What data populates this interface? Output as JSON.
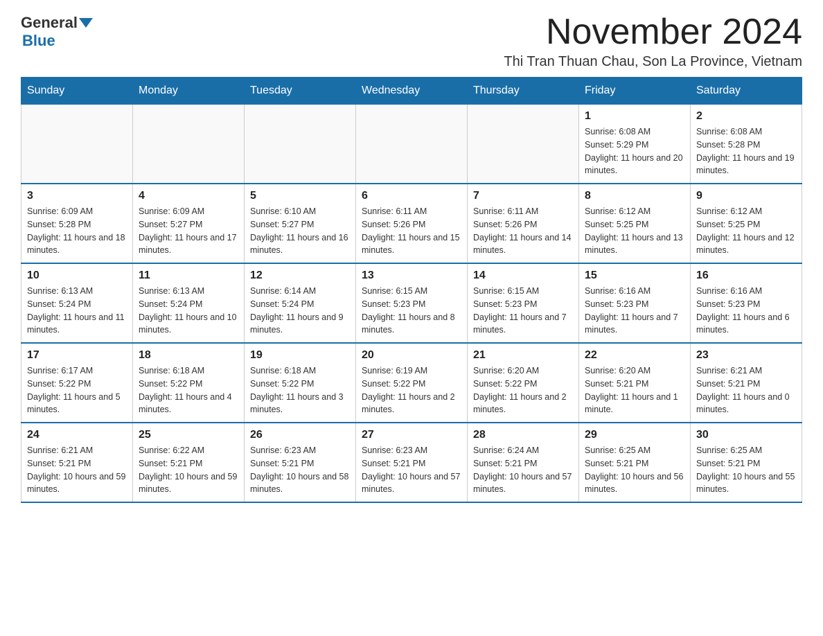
{
  "logo": {
    "general": "General",
    "blue": "Blue"
  },
  "header": {
    "month_title": "November 2024",
    "location": "Thi Tran Thuan Chau, Son La Province, Vietnam"
  },
  "weekdays": [
    "Sunday",
    "Monday",
    "Tuesday",
    "Wednesday",
    "Thursday",
    "Friday",
    "Saturday"
  ],
  "weeks": [
    [
      {
        "day": "",
        "info": ""
      },
      {
        "day": "",
        "info": ""
      },
      {
        "day": "",
        "info": ""
      },
      {
        "day": "",
        "info": ""
      },
      {
        "day": "",
        "info": ""
      },
      {
        "day": "1",
        "info": "Sunrise: 6:08 AM\nSunset: 5:29 PM\nDaylight: 11 hours and 20 minutes."
      },
      {
        "day": "2",
        "info": "Sunrise: 6:08 AM\nSunset: 5:28 PM\nDaylight: 11 hours and 19 minutes."
      }
    ],
    [
      {
        "day": "3",
        "info": "Sunrise: 6:09 AM\nSunset: 5:28 PM\nDaylight: 11 hours and 18 minutes."
      },
      {
        "day": "4",
        "info": "Sunrise: 6:09 AM\nSunset: 5:27 PM\nDaylight: 11 hours and 17 minutes."
      },
      {
        "day": "5",
        "info": "Sunrise: 6:10 AM\nSunset: 5:27 PM\nDaylight: 11 hours and 16 minutes."
      },
      {
        "day": "6",
        "info": "Sunrise: 6:11 AM\nSunset: 5:26 PM\nDaylight: 11 hours and 15 minutes."
      },
      {
        "day": "7",
        "info": "Sunrise: 6:11 AM\nSunset: 5:26 PM\nDaylight: 11 hours and 14 minutes."
      },
      {
        "day": "8",
        "info": "Sunrise: 6:12 AM\nSunset: 5:25 PM\nDaylight: 11 hours and 13 minutes."
      },
      {
        "day": "9",
        "info": "Sunrise: 6:12 AM\nSunset: 5:25 PM\nDaylight: 11 hours and 12 minutes."
      }
    ],
    [
      {
        "day": "10",
        "info": "Sunrise: 6:13 AM\nSunset: 5:24 PM\nDaylight: 11 hours and 11 minutes."
      },
      {
        "day": "11",
        "info": "Sunrise: 6:13 AM\nSunset: 5:24 PM\nDaylight: 11 hours and 10 minutes."
      },
      {
        "day": "12",
        "info": "Sunrise: 6:14 AM\nSunset: 5:24 PM\nDaylight: 11 hours and 9 minutes."
      },
      {
        "day": "13",
        "info": "Sunrise: 6:15 AM\nSunset: 5:23 PM\nDaylight: 11 hours and 8 minutes."
      },
      {
        "day": "14",
        "info": "Sunrise: 6:15 AM\nSunset: 5:23 PM\nDaylight: 11 hours and 7 minutes."
      },
      {
        "day": "15",
        "info": "Sunrise: 6:16 AM\nSunset: 5:23 PM\nDaylight: 11 hours and 7 minutes."
      },
      {
        "day": "16",
        "info": "Sunrise: 6:16 AM\nSunset: 5:23 PM\nDaylight: 11 hours and 6 minutes."
      }
    ],
    [
      {
        "day": "17",
        "info": "Sunrise: 6:17 AM\nSunset: 5:22 PM\nDaylight: 11 hours and 5 minutes."
      },
      {
        "day": "18",
        "info": "Sunrise: 6:18 AM\nSunset: 5:22 PM\nDaylight: 11 hours and 4 minutes."
      },
      {
        "day": "19",
        "info": "Sunrise: 6:18 AM\nSunset: 5:22 PM\nDaylight: 11 hours and 3 minutes."
      },
      {
        "day": "20",
        "info": "Sunrise: 6:19 AM\nSunset: 5:22 PM\nDaylight: 11 hours and 2 minutes."
      },
      {
        "day": "21",
        "info": "Sunrise: 6:20 AM\nSunset: 5:22 PM\nDaylight: 11 hours and 2 minutes."
      },
      {
        "day": "22",
        "info": "Sunrise: 6:20 AM\nSunset: 5:21 PM\nDaylight: 11 hours and 1 minute."
      },
      {
        "day": "23",
        "info": "Sunrise: 6:21 AM\nSunset: 5:21 PM\nDaylight: 11 hours and 0 minutes."
      }
    ],
    [
      {
        "day": "24",
        "info": "Sunrise: 6:21 AM\nSunset: 5:21 PM\nDaylight: 10 hours and 59 minutes."
      },
      {
        "day": "25",
        "info": "Sunrise: 6:22 AM\nSunset: 5:21 PM\nDaylight: 10 hours and 59 minutes."
      },
      {
        "day": "26",
        "info": "Sunrise: 6:23 AM\nSunset: 5:21 PM\nDaylight: 10 hours and 58 minutes."
      },
      {
        "day": "27",
        "info": "Sunrise: 6:23 AM\nSunset: 5:21 PM\nDaylight: 10 hours and 57 minutes."
      },
      {
        "day": "28",
        "info": "Sunrise: 6:24 AM\nSunset: 5:21 PM\nDaylight: 10 hours and 57 minutes."
      },
      {
        "day": "29",
        "info": "Sunrise: 6:25 AM\nSunset: 5:21 PM\nDaylight: 10 hours and 56 minutes."
      },
      {
        "day": "30",
        "info": "Sunrise: 6:25 AM\nSunset: 5:21 PM\nDaylight: 10 hours and 55 minutes."
      }
    ]
  ]
}
